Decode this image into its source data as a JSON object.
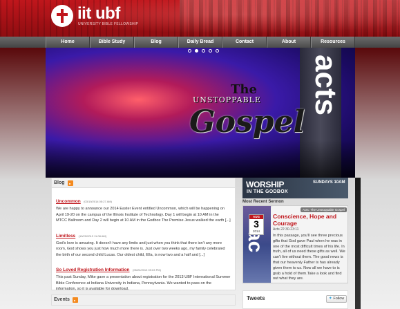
{
  "header": {
    "logo_text": "iit ubf",
    "logo_sub": "UNIVERSITY BIBLE FELLOWSHIP"
  },
  "nav": {
    "items": [
      "Home",
      "Bible Study",
      "Blog",
      "Daily Bread",
      "Contact",
      "About",
      "Resources"
    ]
  },
  "slider": {
    "dots": 5,
    "active_index": 1,
    "line_the": "The",
    "line_unstoppable": "UNSTOPPABLE",
    "line_gospel": "Gospel",
    "side_text": "acts"
  },
  "blog": {
    "heading": "Blog",
    "posts": [
      {
        "title": "Uncommon",
        "date": "(03/19/2014 05:27 AM)",
        "body": "We are happy to announce our 2014 Easter Event entitled Uncommon, which will be happening on April 19-20 on the campus of the Illinois Institute of Technology. Day 1 will begin at 10 AM in the MTCC Ballroom and Day 2 will begin at 10 AM in the Godbox The Premise Jesus walked the earth [...]"
      },
      {
        "title": "Limitless",
        "date": "(10/29/2013 11:08 AM)",
        "body": "God's love is amazing. It doesn't have any limits and just when you think that there isn't any more room, God shows you just how much more there is. Just over two weeks ago, my family celebrated the birth of our second child Lucas. Our oldest child, Ella, is now two and a half and [...]"
      },
      {
        "title": "So Loved Registration Information",
        "date": "(05/22/2013 09:03 PM)",
        "body": "This past Sunday, Mike gave a presentation about registration for the 2013 UBF International Summer Bible Conference at Indiana University in Indiana, Pennsylvania. We wanted to pass on the information, so it is available for download."
      }
    ]
  },
  "events": {
    "heading": "Events"
  },
  "worship": {
    "title": "WORSHIP",
    "subtitle": "IN THE GODBOX",
    "time": "SUNDAYS 10AM"
  },
  "sermon": {
    "label": "Most Recent Sermon",
    "tag": "Acts: The Unstoppable Gospel",
    "title": "Conscience, Hope and Courage",
    "reference": "Acts 22:30-23:11",
    "body": "In this passage, you'll see three precious gifts that God gave Paul when he was in one of the most difficult times of his life. In truth, all of us need these gifts as well. We can't live without them. The good news is that our heavenly Father is has already given them to us. Now all we have to is grab a hold of them.Take a look and find out what they are.",
    "month": "AUG",
    "day": "3",
    "year": "2014",
    "art_text": "ac"
  },
  "tweets": {
    "heading": "Tweets",
    "follow_label": "Follow"
  },
  "colors": {
    "brand_red": "#c0161c",
    "nav_gray": "#5a5a5a",
    "rss_orange": "#f48a1f"
  }
}
